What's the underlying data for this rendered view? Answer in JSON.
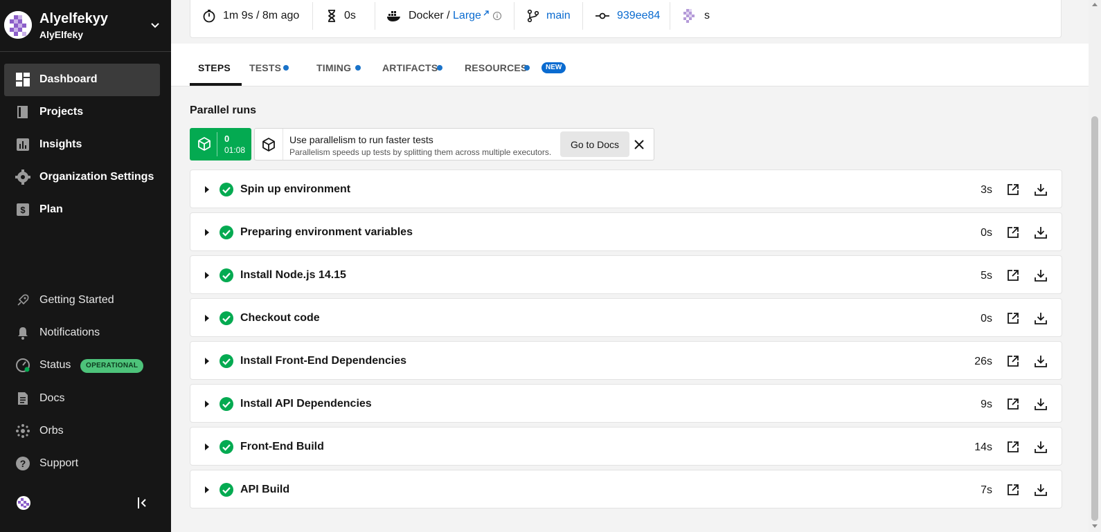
{
  "org": {
    "name": "Alyelfekyy",
    "user": "AlyElfeky"
  },
  "nav": {
    "primary": [
      {
        "label": "Dashboard",
        "icon": "dashboard-icon",
        "active": true
      },
      {
        "label": "Projects",
        "icon": "projects-icon"
      },
      {
        "label": "Insights",
        "icon": "insights-icon"
      },
      {
        "label": "Organization Settings",
        "icon": "gear-icon"
      },
      {
        "label": "Plan",
        "icon": "plan-icon"
      }
    ],
    "secondary": [
      {
        "label": "Getting Started",
        "icon": "rocket-icon"
      },
      {
        "label": "Notifications",
        "icon": "bell-icon"
      },
      {
        "label": "Status",
        "icon": "status-gauge-icon",
        "badge": "OPERATIONAL"
      },
      {
        "label": "Docs",
        "icon": "document-icon"
      },
      {
        "label": "Orbs",
        "icon": "orbs-icon"
      },
      {
        "label": "Support",
        "icon": "help-icon"
      }
    ]
  },
  "job": {
    "duration": "1m 9s / 8m ago",
    "queued": "0s",
    "executor": "Docker / ",
    "resource_class": "Large",
    "branch": "main",
    "commit": "939ee84",
    "author": "s"
  },
  "tabs": [
    {
      "label": "STEPS",
      "active": true
    },
    {
      "label": "TESTS"
    },
    {
      "label": "TIMING"
    },
    {
      "label": "ARTIFACTS"
    },
    {
      "label": "RESOURCES",
      "badge": "NEW"
    }
  ],
  "parallel": {
    "title": "Parallel runs",
    "run_index": "0",
    "run_time": "01:08",
    "tip_title": "Use parallelism to run faster tests",
    "tip_subtitle": "Parallelism speeds up tests by splitting them across multiple executors.",
    "docs_button": "Go to Docs"
  },
  "steps": [
    {
      "name": "Spin up environment",
      "duration": "3s"
    },
    {
      "name": "Preparing environment variables",
      "duration": "0s"
    },
    {
      "name": "Install Node.js 14.15",
      "duration": "5s"
    },
    {
      "name": "Checkout code",
      "duration": "0s"
    },
    {
      "name": "Install Front-End Dependencies",
      "duration": "26s"
    },
    {
      "name": "Install API Dependencies",
      "duration": "9s"
    },
    {
      "name": "Front-End Build",
      "duration": "14s"
    },
    {
      "name": "API Build",
      "duration": "7s"
    }
  ],
  "colors": {
    "success": "#04aa51",
    "link": "#0a6bd0",
    "sidebar": "#161616",
    "status_badge": "#4dc37a"
  }
}
